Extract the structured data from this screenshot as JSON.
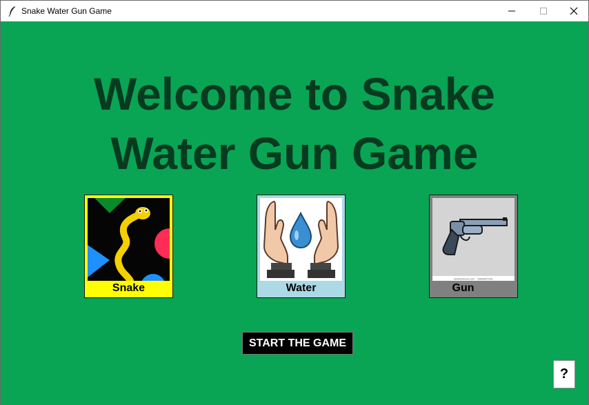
{
  "window": {
    "title": "Snake Water Gun Game"
  },
  "main": {
    "heading_line1": "Welcome to Snake",
    "heading_line2": "Water Gun Game",
    "choices": [
      {
        "label": "Snake",
        "bg_color": "#ffff00",
        "icon": "snake-icon"
      },
      {
        "label": "Water",
        "bg_color": "#add8e6",
        "icon": "water-drop-hands-icon"
      },
      {
        "label": "Gun",
        "bg_color": "#808080",
        "icon": "revolver-icon"
      }
    ],
    "gun_image_watermark": "shutterstock.com · 2366087299",
    "start_button_label": "START THE GAME",
    "help_button_label": "?"
  },
  "colors": {
    "background": "#0aa455",
    "heading": "#073b20",
    "start_button_bg": "#000000"
  }
}
